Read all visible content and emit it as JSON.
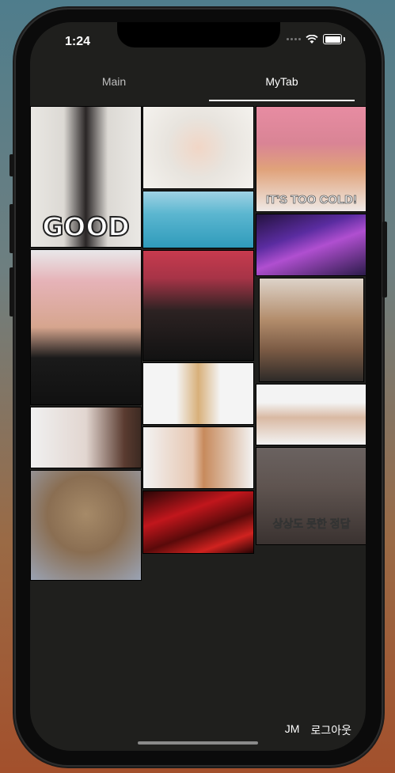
{
  "status_bar": {
    "time": "1:24"
  },
  "tabs": [
    {
      "label": "Main",
      "active": false
    },
    {
      "label": "MyTab",
      "active": true
    }
  ],
  "gifs": [
    {
      "caption": "GOOD"
    },
    {
      "caption": ""
    },
    {
      "caption": "IT'S TOO COLD!"
    },
    {
      "caption": ""
    },
    {
      "caption": ""
    },
    {
      "caption": ""
    },
    {
      "caption": ""
    },
    {
      "caption": ""
    },
    {
      "caption": ""
    },
    {
      "caption": ""
    },
    {
      "caption": ""
    },
    {
      "caption": ""
    },
    {
      "caption": ""
    },
    {
      "caption": ""
    },
    {
      "caption": "상상도 못한 정답"
    }
  ],
  "footer": {
    "user": "JM",
    "logout": "로그아웃"
  }
}
